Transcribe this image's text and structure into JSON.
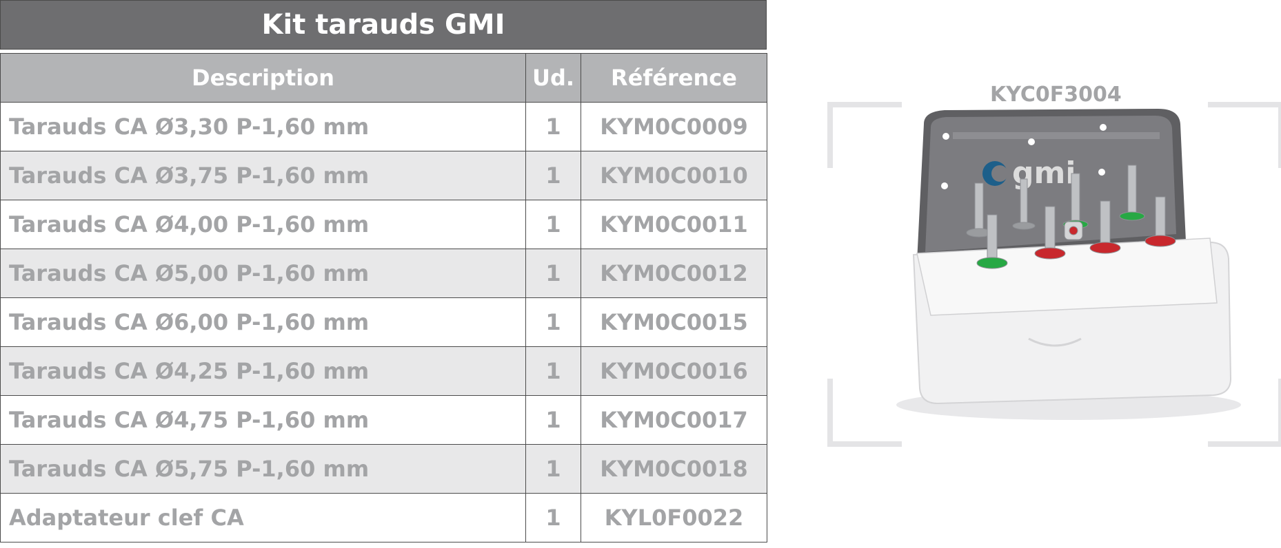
{
  "title": "Kit tarauds GMI",
  "columns": [
    "Description",
    "Ud.",
    "Référence"
  ],
  "rows": [
    {
      "description": "Tarauds CA Ø3,30 P-1,60 mm",
      "ud": "1",
      "reference": "KYM0C0009"
    },
    {
      "description": "Tarauds CA Ø3,75 P-1,60 mm",
      "ud": "1",
      "reference": "KYM0C0010"
    },
    {
      "description": "Tarauds CA Ø4,00 P-1,60 mm",
      "ud": "1",
      "reference": "KYM0C0011"
    },
    {
      "description": "Tarauds CA Ø5,00 P-1,60 mm",
      "ud": "1",
      "reference": "KYM0C0012"
    },
    {
      "description": "Tarauds CA Ø6,00 P-1,60 mm",
      "ud": "1",
      "reference": "KYM0C0015"
    },
    {
      "description": "Tarauds CA Ø4,25 P-1,60 mm",
      "ud": "1",
      "reference": "KYM0C0016"
    },
    {
      "description": "Tarauds CA Ø4,75 P-1,60 mm",
      "ud": "1",
      "reference": "KYM0C0017"
    },
    {
      "description": "Tarauds CA Ø5,75 P-1,60 mm",
      "ud": "1",
      "reference": "KYM0C0018"
    },
    {
      "description": "Adaptateur clef CA",
      "ud": "1",
      "reference": "KYL0F0022"
    }
  ],
  "product": {
    "reference": "KYC0F3004",
    "logo_text": "gmi"
  },
  "colors": {
    "title_bg": "#6e6e70",
    "header_bg": "#b3b4b6",
    "row_shade": "#e8e8e9",
    "text_grey": "#a3a4a6",
    "ring_green": "#27a844",
    "ring_red": "#c8282d"
  }
}
